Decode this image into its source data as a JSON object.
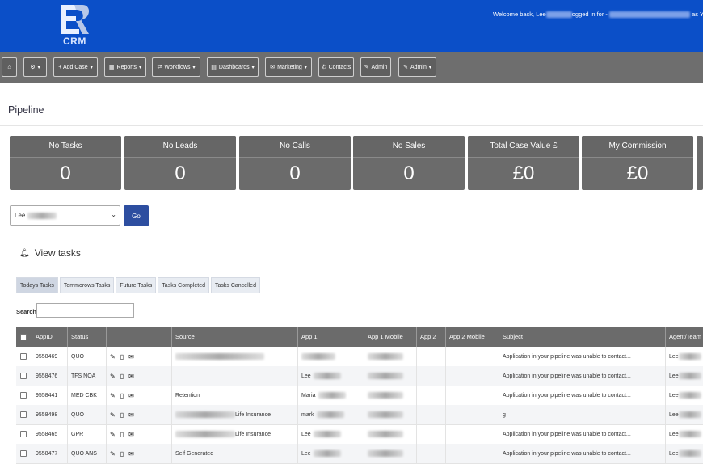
{
  "header": {
    "logo_sub": "CRM",
    "welcome_prefix": "Welcome back, Lee",
    "welcome_mid": "ogged in for -",
    "welcome_suffix": "as You"
  },
  "nav": {
    "home_icon": "home-icon",
    "settings_icon": "gear-icon",
    "items": [
      {
        "label": "+ Add Case"
      },
      {
        "label": "Reports"
      },
      {
        "label": "Workflows"
      },
      {
        "label": "Dashboards"
      },
      {
        "label": "Marketing"
      },
      {
        "label": "Contacts"
      },
      {
        "label": "Admin"
      },
      {
        "label": "Admin"
      }
    ]
  },
  "page_title": "Pipeline",
  "stats": [
    {
      "label": "No Tasks",
      "value": "0"
    },
    {
      "label": "No Leads",
      "value": "0"
    },
    {
      "label": "No Calls",
      "value": "0"
    },
    {
      "label": "No Sales",
      "value": "0"
    },
    {
      "label": "Total Case Value £",
      "value": "£0"
    },
    {
      "label": "My Commission",
      "value": "£0"
    }
  ],
  "agent_select": {
    "value": "Lee"
  },
  "go_label": "Go",
  "view_tasks_label": "View tasks",
  "tabs": [
    {
      "label": "Todays Tasks"
    },
    {
      "label": "Tommorows Tasks"
    },
    {
      "label": "Future Tasks"
    },
    {
      "label": "Tasks Completed"
    },
    {
      "label": "Tasks Cancelled"
    }
  ],
  "search_label": "Search:",
  "table": {
    "columns": [
      {
        "label": ""
      },
      {
        "label": "AppID"
      },
      {
        "label": "Status"
      },
      {
        "label": ""
      },
      {
        "label": "Source"
      },
      {
        "label": "App 1"
      },
      {
        "label": "App 1 Mobile"
      },
      {
        "label": "App 2"
      },
      {
        "label": "App 2 Mobile"
      },
      {
        "label": "Subject"
      },
      {
        "label": "Agent/Team"
      }
    ],
    "rows": [
      {
        "appid": "9558469",
        "status": "QUO",
        "source": "",
        "app1": "",
        "subject": "Application in your pipeline was unable to contact...",
        "agent": "Lee"
      },
      {
        "appid": "9558476",
        "status": "TFS NOA",
        "source": "",
        "app1": "Lee",
        "subject": "Application in your pipeline was unable to contact...",
        "agent": "Lee"
      },
      {
        "appid": "9558441",
        "status": "MED CBK",
        "source": "Retention",
        "app1": "Maria",
        "subject": "Application in your pipeline was unable to contact...",
        "agent": "Lee"
      },
      {
        "appid": "9558498",
        "status": "QUO",
        "source": "Life Insurance",
        "app1": "mark",
        "subject": "g",
        "agent": "Lee"
      },
      {
        "appid": "9558465",
        "status": "GPR",
        "source": "Life Insurance",
        "app1": "Lee",
        "subject": "Application in your pipeline was unable to contact...",
        "agent": "Lee"
      },
      {
        "appid": "9558477",
        "status": "QUO ANS",
        "source": "Self Generated",
        "app1": "Lee",
        "subject": "Application in your pipeline was unable to contact...",
        "agent": "Lee"
      }
    ]
  }
}
